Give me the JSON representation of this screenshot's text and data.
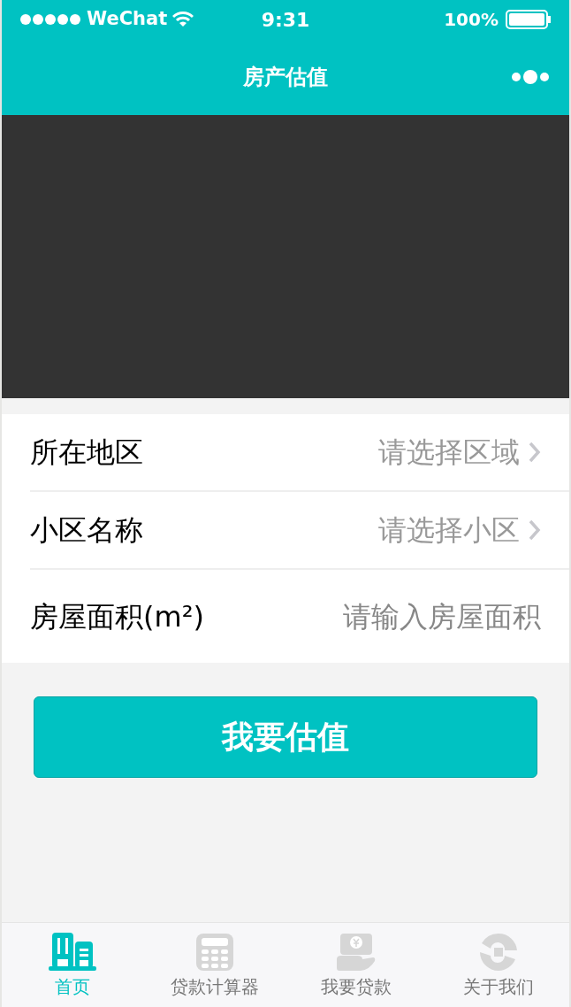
{
  "status_bar": {
    "carrier": "WeChat",
    "time": "9:31",
    "battery": "100%"
  },
  "nav_bar": {
    "title": "房产估值"
  },
  "form": {
    "rows": [
      {
        "kind": "select",
        "label": "所在地区",
        "value": "请选择区域"
      },
      {
        "kind": "select",
        "label": "小区名称",
        "value": "请选择小区"
      },
      {
        "kind": "input",
        "label": "房屋面积(m²)",
        "placeholder": "请输入房屋面积"
      }
    ]
  },
  "submit_button": "我要估值",
  "tab_bar": [
    {
      "kind": "home",
      "label": "首页",
      "selected": true
    },
    {
      "kind": "calculator",
      "label": "贷款计算器",
      "selected": false
    },
    {
      "kind": "loan",
      "label": "我要贷款",
      "selected": false
    },
    {
      "kind": "about",
      "label": "关于我们",
      "selected": false
    }
  ]
}
